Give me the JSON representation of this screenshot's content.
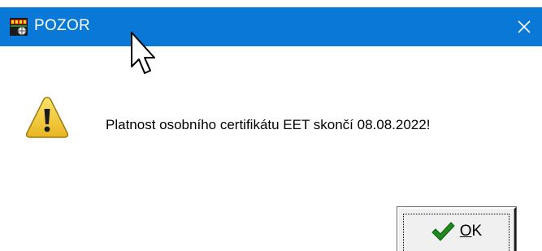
{
  "window": {
    "title": "POZOR",
    "titlebar_color": "#0a78d7",
    "app_icon": "app-icon",
    "close_icon": "close-icon"
  },
  "dialog": {
    "icon": "warning-icon",
    "message": "Platnost osobního certifikátu EET skončí 08.08.2022!"
  },
  "buttons": {
    "ok": {
      "mnemonic": "O",
      "rest": "K",
      "icon": "checkmark-icon",
      "icon_color": "#1e8a1e"
    }
  }
}
